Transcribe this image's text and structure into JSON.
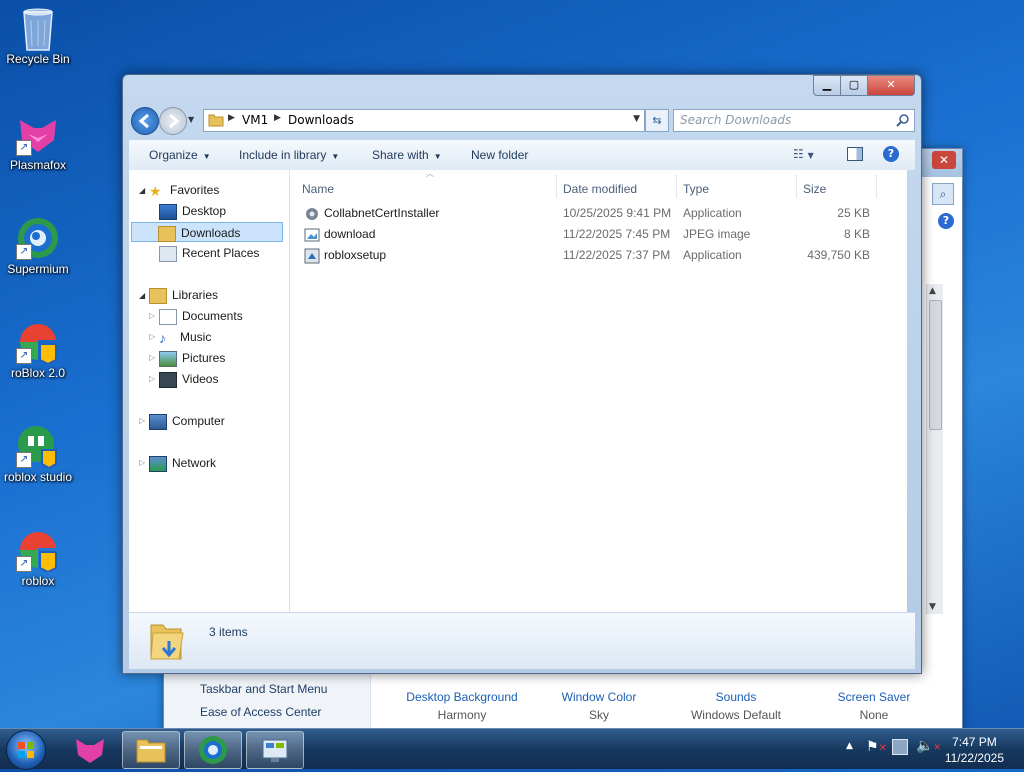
{
  "desktop": {
    "icons": [
      {
        "label": "Recycle Bin"
      },
      {
        "label": "Plasmafox"
      },
      {
        "label": "Supermium"
      },
      {
        "label": "roBlox 2.0"
      },
      {
        "label": "roblox studio"
      },
      {
        "label": "roblox"
      }
    ]
  },
  "background_window": {
    "links": [
      "Taskbar and Start Menu",
      "Ease of Access Center"
    ],
    "items": [
      {
        "title": "Desktop Background",
        "sub": "Harmony"
      },
      {
        "title": "Window Color",
        "sub": "Sky"
      },
      {
        "title": "Sounds",
        "sub": "Windows Default"
      },
      {
        "title": "Screen Saver",
        "sub": "None"
      }
    ]
  },
  "explorer": {
    "address": {
      "segments": [
        "VM1",
        "Downloads"
      ]
    },
    "search": {
      "placeholder": "Search Downloads"
    },
    "toolbar": {
      "organize": "Organize",
      "include_in_library": "Include in library",
      "share_with": "Share with",
      "new_folder": "New folder"
    },
    "nav": {
      "favorites": "Favorites",
      "favorites_items": [
        "Desktop",
        "Downloads",
        "Recent Places"
      ],
      "libraries": "Libraries",
      "libraries_items": [
        "Documents",
        "Music",
        "Pictures",
        "Videos"
      ],
      "computer": "Computer",
      "network": "Network"
    },
    "columns": {
      "name": "Name",
      "date": "Date modified",
      "type": "Type",
      "size": "Size"
    },
    "files": [
      {
        "name": "CollabnetCertInstaller",
        "date": "10/25/2025 9:41 PM",
        "type": "Application",
        "size": "25 KB"
      },
      {
        "name": "download",
        "date": "11/22/2025 7:45 PM",
        "type": "JPEG image",
        "size": "8 KB"
      },
      {
        "name": "robloxsetup",
        "date": "11/22/2025 7:37 PM",
        "type": "Application",
        "size": "439,750 KB"
      }
    ],
    "status": {
      "count": "3 items"
    }
  },
  "taskbar": {
    "clock": {
      "time": "7:47 PM",
      "date": "11/22/2025"
    }
  },
  "colors": {
    "accent": "#1a5fb4",
    "selection": "#cce4fb",
    "close_red": "#c9463d"
  }
}
